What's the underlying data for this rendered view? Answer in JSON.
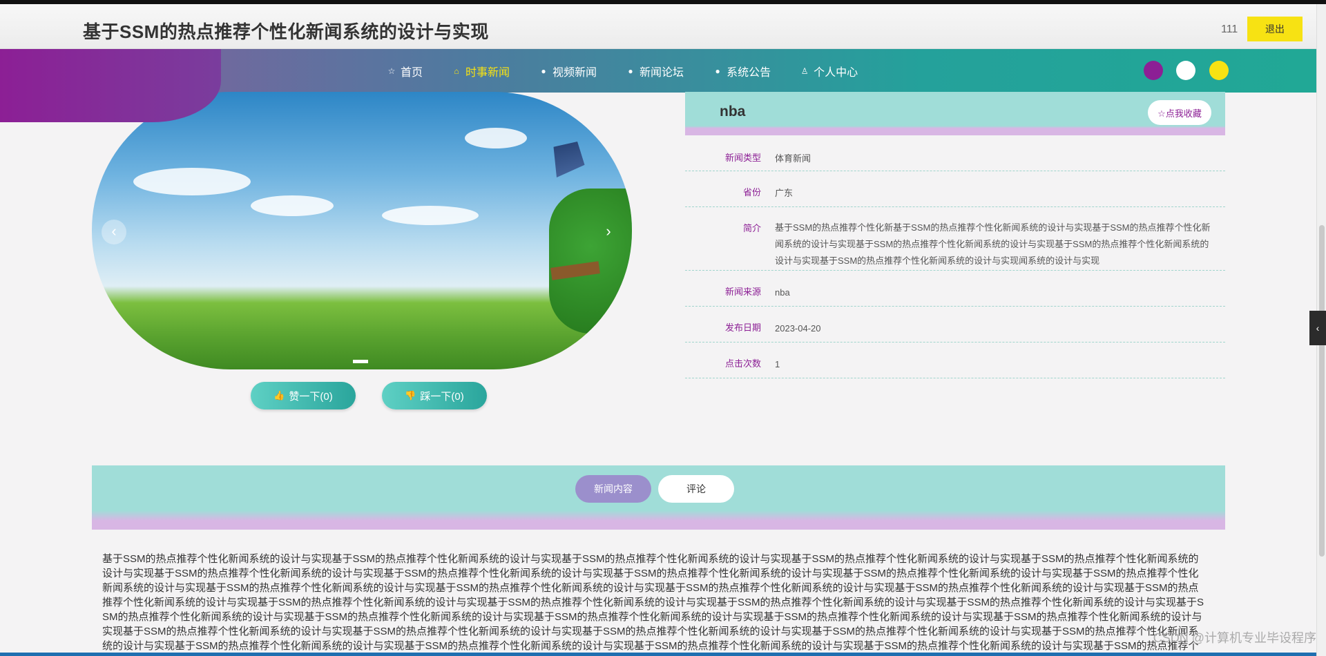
{
  "header": {
    "site_title": "基于SSM的热点推荐个性化新闻系统的设计与实现",
    "username": "111",
    "logout_label": "退出"
  },
  "nav": {
    "items": [
      {
        "icon": "star-outline-icon",
        "glyph": "☆",
        "label": "首页",
        "active": false
      },
      {
        "icon": "lock-icon",
        "glyph": "⌂",
        "label": "时事新闻",
        "active": true
      },
      {
        "icon": "info-circle-icon",
        "glyph": "●",
        "label": "视频新闻",
        "active": false
      },
      {
        "icon": "help-circle-icon",
        "glyph": "●",
        "label": "新闻论坛",
        "active": false
      },
      {
        "icon": "info-circle-icon",
        "glyph": "●",
        "label": "系统公告",
        "active": false
      },
      {
        "icon": "user-icon",
        "glyph": "♙",
        "label": "个人中心",
        "active": false
      }
    ],
    "theme_colors": [
      "#8c1f95",
      "#ffffff",
      "#f7e213"
    ]
  },
  "carousel": {
    "prev_glyph": "‹",
    "next_glyph": "›"
  },
  "votes": {
    "like_label": "赞一下(0)",
    "dislike_label": "踩一下(0)"
  },
  "detail": {
    "title": "nba",
    "favorite_label": "☆点我收藏",
    "fields": [
      {
        "label": "新闻类型",
        "value": "体育新闻"
      },
      {
        "label": "省份",
        "value": "广东"
      },
      {
        "label": "简介",
        "value": "基于SSM的热点推荐个性化新基于SSM的热点推荐个性化新闻系统的设计与实现基于SSM的热点推荐个性化新闻系统的设计与实现基于SSM的热点推荐个性化新闻系统的设计与实现基于SSM的热点推荐个性化新闻系统的设计与实现基于SSM的热点推荐个性化新闻系统的设计与实现闻系统的设计与实现"
      },
      {
        "label": "新闻来源",
        "value": "nba"
      },
      {
        "label": "发布日期",
        "value": "2023-04-20"
      },
      {
        "label": "点击次数",
        "value": "1"
      }
    ]
  },
  "tabs": [
    {
      "label": "新闻内容",
      "active": true
    },
    {
      "label": "评论",
      "active": false
    }
  ],
  "article": {
    "text": "基于SSM的热点推荐个性化新闻系统的设计与实现基于SSM的热点推荐个性化新闻系统的设计与实现基于SSM的热点推荐个性化新闻系统的设计与实现基于SSM的热点推荐个性化新闻系统的设计与实现基于SSM的热点推荐个性化新闻系统的设计与实现基于SSM的热点推荐个性化新闻系统的设计与实现基于SSM的热点推荐个性化新闻系统的设计与实现基于SSM的热点推荐个性化新闻系统的设计与实现基于SSM的热点推荐个性化新闻系统的设计与实现基于SSM的热点推荐个性化新闻系统的设计与实现基于SSM的热点推荐个性化新闻系统的设计与实现基于SSM的热点推荐个性化新闻系统的设计与实现基于SSM的热点推荐个性化新闻系统的设计与实现基于SSM的热点推荐个性化新闻系统的设计与实现基于SSM的热点推荐个性化新闻系统的设计与实现基于SSM的热点推荐个性化新闻系统的设计与实现基于SSM的热点推荐个性化新闻系统的设计与实现基于SSM的热点推荐个性化新闻系统的设计与实现基于SSM的热点推荐个性化新闻系统的设计与实现基于SSM的热点推荐个性化新闻系统的设计与实现基于SSM的热点推荐个性化新闻系统的设计与实现基于SSM的热点推荐个性化新闻系统的设计与实现基于SSM的热点推荐个性化新闻系统的设计与实现基于SSM的热点推荐个性化新闻系统的设计与实现基于SSM的热点推荐个性化新闻系统的设计与实现基于SSM的热点推荐个性化新闻系统的设计与实现基于SSM的热点推荐个性化新闻系统的设计与实现基于SSM的热点推荐个性化新闻系统的设计与实现基于SSM的热点推荐个性化新闻系统的设计与实现基于SSM的热点推荐个性化新闻系统的设计与实现基于SSM的热点推荐个性化新闻系统的设计与实现基于SSM的热点推荐个性化新闻系统的设计与实现基于SSM的热点推荐个性化新闻系统的设计与实现基于SSM的热点推荐个性化新闻系统的设计与实现"
  },
  "sidebar_toggle_glyph": "‹",
  "watermark": "CSDN @计算机专业毕设程序"
}
